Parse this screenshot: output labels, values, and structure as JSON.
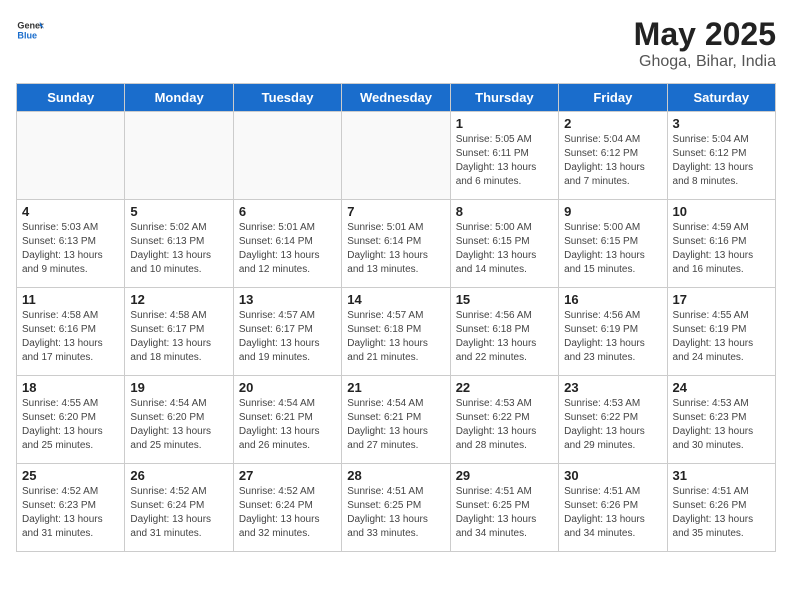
{
  "header": {
    "logo_general": "General",
    "logo_blue": "Blue",
    "title": "May 2025",
    "location": "Ghoga, Bihar, India"
  },
  "weekdays": [
    "Sunday",
    "Monday",
    "Tuesday",
    "Wednesday",
    "Thursday",
    "Friday",
    "Saturday"
  ],
  "weeks": [
    [
      {
        "day": "",
        "empty": true
      },
      {
        "day": "",
        "empty": true
      },
      {
        "day": "",
        "empty": true
      },
      {
        "day": "",
        "empty": true
      },
      {
        "day": "1",
        "sunrise": "5:05 AM",
        "sunset": "6:11 PM",
        "daylight": "13 hours and 6 minutes."
      },
      {
        "day": "2",
        "sunrise": "5:04 AM",
        "sunset": "6:12 PM",
        "daylight": "13 hours and 7 minutes."
      },
      {
        "day": "3",
        "sunrise": "5:04 AM",
        "sunset": "6:12 PM",
        "daylight": "13 hours and 8 minutes."
      }
    ],
    [
      {
        "day": "4",
        "sunrise": "5:03 AM",
        "sunset": "6:13 PM",
        "daylight": "13 hours and 9 minutes."
      },
      {
        "day": "5",
        "sunrise": "5:02 AM",
        "sunset": "6:13 PM",
        "daylight": "13 hours and 10 minutes."
      },
      {
        "day": "6",
        "sunrise": "5:01 AM",
        "sunset": "6:14 PM",
        "daylight": "13 hours and 12 minutes."
      },
      {
        "day": "7",
        "sunrise": "5:01 AM",
        "sunset": "6:14 PM",
        "daylight": "13 hours and 13 minutes."
      },
      {
        "day": "8",
        "sunrise": "5:00 AM",
        "sunset": "6:15 PM",
        "daylight": "13 hours and 14 minutes."
      },
      {
        "day": "9",
        "sunrise": "5:00 AM",
        "sunset": "6:15 PM",
        "daylight": "13 hours and 15 minutes."
      },
      {
        "day": "10",
        "sunrise": "4:59 AM",
        "sunset": "6:16 PM",
        "daylight": "13 hours and 16 minutes."
      }
    ],
    [
      {
        "day": "11",
        "sunrise": "4:58 AM",
        "sunset": "6:16 PM",
        "daylight": "13 hours and 17 minutes."
      },
      {
        "day": "12",
        "sunrise": "4:58 AM",
        "sunset": "6:17 PM",
        "daylight": "13 hours and 18 minutes."
      },
      {
        "day": "13",
        "sunrise": "4:57 AM",
        "sunset": "6:17 PM",
        "daylight": "13 hours and 19 minutes."
      },
      {
        "day": "14",
        "sunrise": "4:57 AM",
        "sunset": "6:18 PM",
        "daylight": "13 hours and 21 minutes."
      },
      {
        "day": "15",
        "sunrise": "4:56 AM",
        "sunset": "6:18 PM",
        "daylight": "13 hours and 22 minutes."
      },
      {
        "day": "16",
        "sunrise": "4:56 AM",
        "sunset": "6:19 PM",
        "daylight": "13 hours and 23 minutes."
      },
      {
        "day": "17",
        "sunrise": "4:55 AM",
        "sunset": "6:19 PM",
        "daylight": "13 hours and 24 minutes."
      }
    ],
    [
      {
        "day": "18",
        "sunrise": "4:55 AM",
        "sunset": "6:20 PM",
        "daylight": "13 hours and 25 minutes."
      },
      {
        "day": "19",
        "sunrise": "4:54 AM",
        "sunset": "6:20 PM",
        "daylight": "13 hours and 25 minutes."
      },
      {
        "day": "20",
        "sunrise": "4:54 AM",
        "sunset": "6:21 PM",
        "daylight": "13 hours and 26 minutes."
      },
      {
        "day": "21",
        "sunrise": "4:54 AM",
        "sunset": "6:21 PM",
        "daylight": "13 hours and 27 minutes."
      },
      {
        "day": "22",
        "sunrise": "4:53 AM",
        "sunset": "6:22 PM",
        "daylight": "13 hours and 28 minutes."
      },
      {
        "day": "23",
        "sunrise": "4:53 AM",
        "sunset": "6:22 PM",
        "daylight": "13 hours and 29 minutes."
      },
      {
        "day": "24",
        "sunrise": "4:53 AM",
        "sunset": "6:23 PM",
        "daylight": "13 hours and 30 minutes."
      }
    ],
    [
      {
        "day": "25",
        "sunrise": "4:52 AM",
        "sunset": "6:23 PM",
        "daylight": "13 hours and 31 minutes."
      },
      {
        "day": "26",
        "sunrise": "4:52 AM",
        "sunset": "6:24 PM",
        "daylight": "13 hours and 31 minutes."
      },
      {
        "day": "27",
        "sunrise": "4:52 AM",
        "sunset": "6:24 PM",
        "daylight": "13 hours and 32 minutes."
      },
      {
        "day": "28",
        "sunrise": "4:51 AM",
        "sunset": "6:25 PM",
        "daylight": "13 hours and 33 minutes."
      },
      {
        "day": "29",
        "sunrise": "4:51 AM",
        "sunset": "6:25 PM",
        "daylight": "13 hours and 34 minutes."
      },
      {
        "day": "30",
        "sunrise": "4:51 AM",
        "sunset": "6:26 PM",
        "daylight": "13 hours and 34 minutes."
      },
      {
        "day": "31",
        "sunrise": "4:51 AM",
        "sunset": "6:26 PM",
        "daylight": "13 hours and 35 minutes."
      }
    ]
  ]
}
